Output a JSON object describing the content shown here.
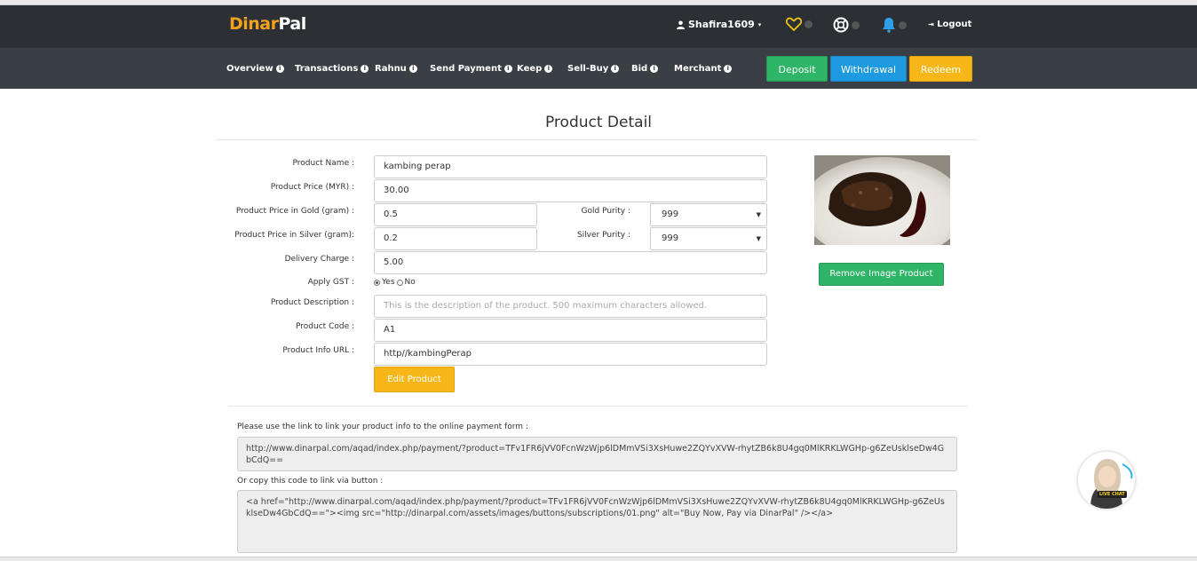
{
  "brand": {
    "part1": "Dinar",
    "part2": "Pal"
  },
  "header": {
    "username": "Shafira1609",
    "logout_label": "Logout"
  },
  "nav": {
    "items": [
      {
        "label": "Overview"
      },
      {
        "label": "Transactions"
      },
      {
        "label": "Rahnu"
      },
      {
        "label": "Send Payment"
      },
      {
        "label": "Keep"
      },
      {
        "label": "Sell-Buy"
      },
      {
        "label": "Bid"
      },
      {
        "label": "Merchant"
      }
    ],
    "deposit_label": "Deposit",
    "withdrawal_label": "Withdrawal",
    "redeem_label": "Redeem"
  },
  "page": {
    "title": "Product Detail"
  },
  "form": {
    "product_name_label": "Product Name :",
    "product_name_value": "kambing perap",
    "product_price_label": "Product Price (MYR) :",
    "product_price_value": "30.00",
    "price_gold_label": "Product Price in Gold (gram) :",
    "price_gold_value": "0.5",
    "gold_purity_label": "Gold Purity :",
    "gold_purity_value": "999",
    "price_silver_label": "Product Price in Silver (gram):",
    "price_silver_value": "0.2",
    "silver_purity_label": "Silver Purity :",
    "silver_purity_value": "999",
    "delivery_label": "Delivery Charge :",
    "delivery_value": "5.00",
    "gst_label": "Apply GST :",
    "gst_yes": "Yes",
    "gst_no": "No",
    "description_label": "Product Description :",
    "description_placeholder": "This is the description of the product. 500 maximum characters allowed.",
    "code_label": "Product Code :",
    "code_value": "A1",
    "info_url_label": "Product Info URL :",
    "info_url_value": "http//kambingPerap",
    "edit_button": "Edit Product",
    "remove_image_button": "Remove Image Product"
  },
  "links": {
    "link_hint": "Please use the link to link your product info to the online payment form :",
    "link_url": "http://www.dinarpal.com/aqad/index.php/payment/?product=TFv1FR6jVV0FcnWzWjp6lDMmVSi3XsHuwe2ZQYvXVW-rhytZB6k8U4gq0MlKRKLWGHp-g6ZeUsklseDw4GbCdQ==",
    "button_hint": "Or copy this code to link via button :",
    "button_code": "<a href=\"http://www.dinarpal.com/aqad/index.php/payment/?product=TFv1FR6jVV0FcnWzWjp6lDMmVSi3XsHuwe2ZQYvXVW-rhytZB6k8U4gq0MlKRKLWGHp-g6ZeUsklseDw4GbCdQ==\"><img src=\"http://dinarpal.com/assets/images/buttons/subscriptions/01.png\" alt=\"Buy Now, Pay via DinarPal\" /></a>"
  },
  "livechat": {
    "label": "LIVE CHAT"
  },
  "icons": {
    "user": "user-icon",
    "wishlist": "heart-icon",
    "support": "lifebuoy-icon",
    "notifications": "bell-icon",
    "logout": "logout-icon",
    "info": "info-icon"
  },
  "colors": {
    "header_bg": "#2c3035",
    "nav_bg": "#3a3f45",
    "brand_orange": "#f1a21d",
    "deposit_green": "#2fb567",
    "withdrawal_blue": "#1e9be0",
    "redeem_yellow": "#f7b718"
  }
}
